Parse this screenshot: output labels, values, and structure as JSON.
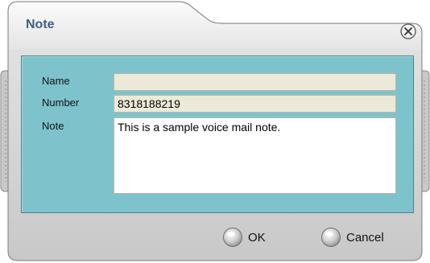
{
  "dialog": {
    "title": "Note",
    "close_icon": "close-icon"
  },
  "fields": {
    "name_label": "Name",
    "name_value": "",
    "number_label": "Number",
    "number_value": "8318188219",
    "note_label": "Note",
    "note_value": "This is a sample voice mail note."
  },
  "buttons": {
    "ok_label": "OK",
    "cancel_label": "Cancel"
  },
  "colors": {
    "title": "#3e5f86",
    "panel": "#7ec3cc",
    "field_bg": "#ece9d8"
  }
}
